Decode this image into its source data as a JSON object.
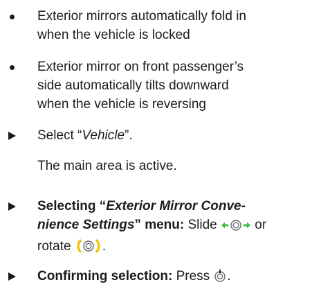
{
  "colors": {
    "text": "#1c1c1c",
    "arrow_green": "#3dbb3d",
    "bracket_yellow": "#f2c200",
    "ring_gray": "#6a6a6a"
  },
  "bullets": [
    {
      "lines": [
        "Exterior mirrors automatically fold in",
        "when the vehicle is locked"
      ]
    },
    {
      "lines": [
        "Exterior mirror on front passenger’s",
        "side automatically tilts downward",
        "when the vehicle is reversing"
      ]
    }
  ],
  "steps": {
    "select_vehicle": {
      "prefix": "Select “",
      "value": "Vehicle",
      "suffix": "”."
    },
    "main_area_note": "The main area is active.",
    "select_menu": {
      "label_open": "Selecting “",
      "menu_name_line1": "Exterior Mirror Conve-",
      "menu_name_line2": "nience Settings",
      "label_close": "” menu:",
      "slide_text": " Slide ",
      "or_text": " or",
      "rotate_text": "rotate ",
      "end_text": ".",
      "slide_icon": "slide-left-right-controller-icon",
      "rotate_icon": "rotate-controller-icon"
    },
    "confirm": {
      "label": "Confirming selection:",
      "action": " Press ",
      "end": ".",
      "icon": "press-controller-icon"
    }
  }
}
